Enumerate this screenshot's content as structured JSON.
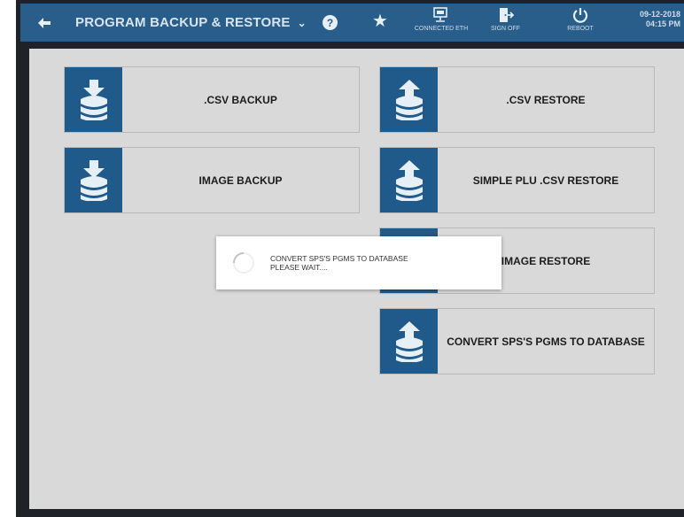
{
  "header": {
    "title": "PROGRAM BACKUP & RESTORE",
    "connected_label": "CONNECTED ETH",
    "signoff_label": "SIGN OFF",
    "reboot_label": "REBOOT",
    "date": "09-12-2018",
    "time": "04:15 PM"
  },
  "tiles": {
    "csv_backup": ".CSV BACKUP",
    "image_backup": "IMAGE BACKUP",
    "csv_restore": ".CSV RESTORE",
    "simple_plu_restore": "SIMPLE PLU .CSV RESTORE",
    "image_restore": "IMAGE RESTORE",
    "convert_sps": "CONVERT SPS'S PGMS TO DATABASE"
  },
  "dialog": {
    "line1": "CONVERT SPS'S PGMS TO DATABASE",
    "line2": "PLEASE WAIT...."
  },
  "colors": {
    "header_bg": "#295d8a",
    "tile_icon_bg": "#205a8a",
    "content_bg": "#d9d9d9"
  }
}
